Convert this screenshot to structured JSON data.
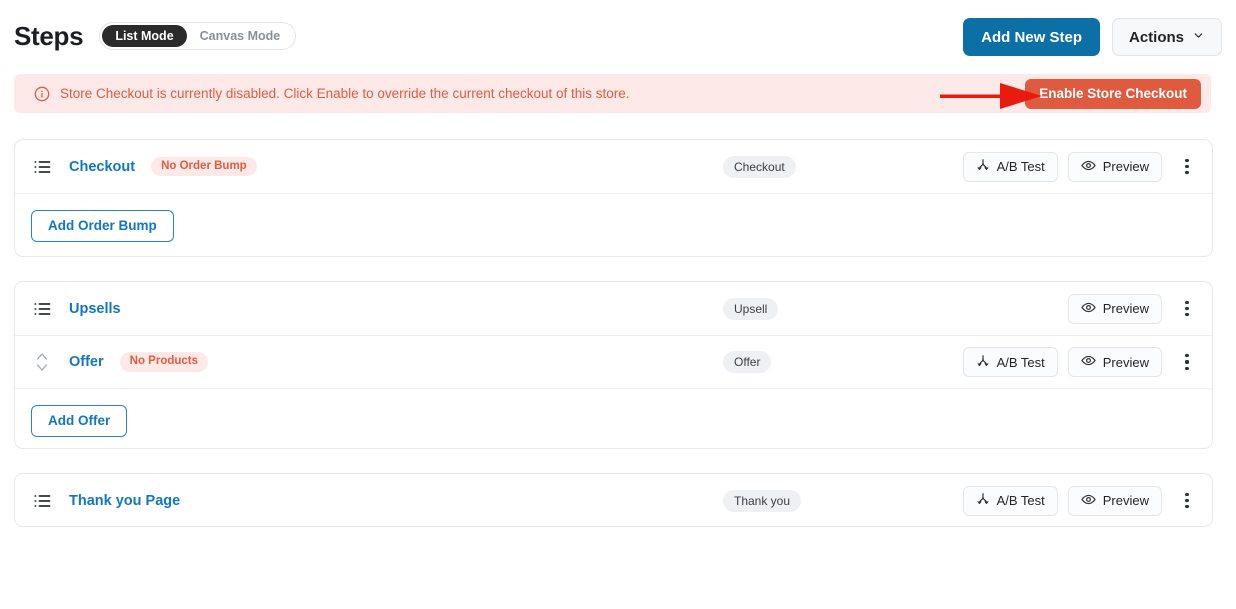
{
  "header": {
    "title": "Steps",
    "modes": [
      {
        "label": "List Mode",
        "active": true
      },
      {
        "label": "Canvas Mode",
        "active": false
      }
    ],
    "add_new_step_label": "Add New Step",
    "actions_label": "Actions"
  },
  "alert": {
    "icon": "info-circle-icon",
    "message": "Store Checkout is currently disabled. Click Enable to override the current checkout of this store.",
    "button_label": "Enable Store Checkout",
    "bg_color": "#fde9e7",
    "text_color": "#e25c43",
    "button_color": "#e05a3f"
  },
  "annotation": {
    "type": "arrow",
    "color": "#e81b0e",
    "points_to": "Enable Store Checkout"
  },
  "cards": [
    {
      "rows": [
        {
          "icon": "list-icon",
          "name": "Checkout",
          "badge": "No Order Bump",
          "type_tag": "Checkout",
          "ab_test_label": "A/B Test",
          "preview_label": "Preview",
          "has_ab_test": true,
          "has_preview": true,
          "kebab": "more-options-icon"
        }
      ],
      "footer_button": "Add Order Bump"
    },
    {
      "rows": [
        {
          "icon": "list-icon",
          "name": "Upsells",
          "badge": "",
          "type_tag": "Upsell",
          "ab_test_label": "A/B Test",
          "preview_label": "Preview",
          "has_ab_test": false,
          "has_preview": true,
          "kebab": "more-options-icon"
        },
        {
          "icon": "sort-updown-icon",
          "name": "Offer",
          "badge": "No Products",
          "type_tag": "Offer",
          "ab_test_label": "A/B Test",
          "preview_label": "Preview",
          "has_ab_test": true,
          "has_preview": true,
          "kebab": "more-options-icon"
        }
      ],
      "footer_button": "Add Offer"
    },
    {
      "rows": [
        {
          "icon": "list-icon",
          "name": "Thank you Page",
          "badge": "",
          "type_tag": "Thank you",
          "ab_test_label": "A/B Test",
          "preview_label": "Preview",
          "has_ab_test": true,
          "has_preview": true,
          "kebab": "more-options-icon"
        }
      ],
      "footer_button": ""
    }
  ],
  "theme": {
    "primary_blue": "#0c6fa5",
    "link_blue": "#1277bf",
    "danger": "#e25c43",
    "page_bg": "#ffffff",
    "card_border": "#e6e8ec"
  }
}
